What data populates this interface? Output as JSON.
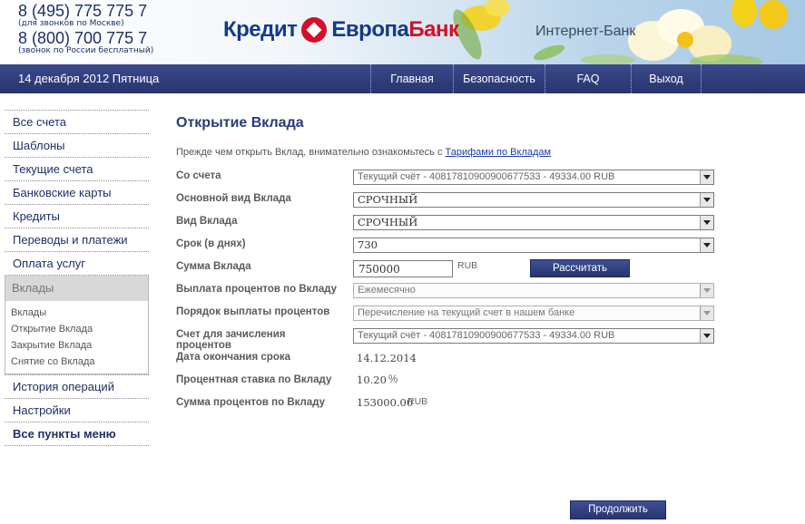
{
  "header": {
    "phone1": "8 (495) 775 775 7",
    "phone1_note": "(для звонков по Москве)",
    "phone2": "8 (800) 700 775 7",
    "phone2_note": "(звонок по России бесплатный)",
    "logo_part1": "Кредит",
    "logo_part2": "Европа",
    "logo_part3": "Банк",
    "tagline": "Интернет-Банк"
  },
  "navbar": {
    "date": "14 декабря 2012 Пятница",
    "items": [
      {
        "label": "Главная"
      },
      {
        "label": "Безопасность"
      },
      {
        "label": "FAQ"
      },
      {
        "label": "Выход"
      }
    ]
  },
  "sidebar": {
    "items_top": [
      {
        "label": "Все счета"
      },
      {
        "label": "Шаблоны"
      },
      {
        "label": "Текущие счета"
      },
      {
        "label": "Банковские карты"
      },
      {
        "label": "Кредиты"
      },
      {
        "label": "Переводы и платежи"
      },
      {
        "label": "Оплата услуг"
      }
    ],
    "active": {
      "label": "Вклады",
      "subitems": [
        {
          "label": "Вклады"
        },
        {
          "label": "Открытие Вклада"
        },
        {
          "label": "Закрытие Вклада"
        },
        {
          "label": "Снятие со Вклада"
        }
      ]
    },
    "items_bottom": [
      {
        "label": "История операций"
      },
      {
        "label": "Настройки"
      },
      {
        "label": "Все пункты меню"
      }
    ]
  },
  "main": {
    "title": "Открытие Вклада",
    "intro_text": "Прежде чем открыть Вклад, внимательно ознакомьтесь с ",
    "intro_link": "Тарифами по Вкладам",
    "fields": {
      "from_account": {
        "label": "Со счета",
        "value": "Текущий счёт - 40817810900900677533 - 49334.00 RUB"
      },
      "main_type": {
        "label": "Основной вид Вклада",
        "value": "СРОЧНЫЙ"
      },
      "type": {
        "label": "Вид Вклада",
        "value": "СРОЧНЫЙ"
      },
      "term": {
        "label": "Срок (в днях)",
        "value": "730"
      },
      "amount": {
        "label": "Сумма Вклада",
        "value": "750000",
        "unit": "RUB"
      },
      "payout": {
        "label": "Выплата процентов по Вкладу",
        "value": "Ежемесячно"
      },
      "payout_order": {
        "label": "Порядок выплаты процентов",
        "value": "Перечисление на текущий счет в нашем банке"
      },
      "interest_account": {
        "label": "Счет для зачисления процентов",
        "value": "Текущий счёт - 40817810900900677533 - 49334.00 RUB"
      },
      "end_date": {
        "label": "Дата окончания срока",
        "value": "14.12.2014"
      },
      "rate": {
        "label": "Процентная ставка по Вкладу",
        "value": "10.20",
        "unit": "%"
      },
      "interest_sum": {
        "label": "Сумма процентов по Вкладу",
        "value": "153000.00",
        "unit": "RUB"
      }
    },
    "calc_button": "Рассчитать",
    "continue_button": "Продолжить"
  },
  "colors": {
    "navy": "#2a3978",
    "brand_red": "#d3102a",
    "brand_blue": "#123a8a"
  }
}
